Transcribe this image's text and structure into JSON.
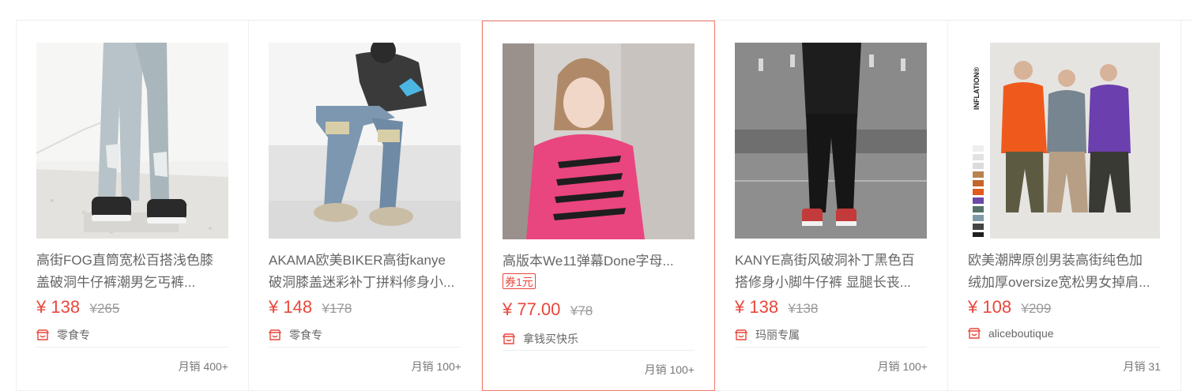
{
  "products": [
    {
      "title_line1": "高街FOG直筒宽松百搭浅色膝",
      "title_line2": "盖破洞牛仔裤潮男乞丐裤...",
      "price": "¥ 138",
      "original_price": "¥265",
      "shop": "零食专",
      "sales": "月销 400+",
      "image_icon": "ripped-jeans-photo"
    },
    {
      "title_line1": "AKAMA欧美BIKER高街kanye",
      "title_line2": "破洞膝盖迷彩补丁拼料修身小...",
      "price": "¥ 148",
      "original_price": "¥178",
      "shop": "零食专",
      "sales": "月销 100+",
      "image_icon": "biker-jeans-photo"
    },
    {
      "title_line1": "高版本We11弹幕Done字母...",
      "coupon": "券1元",
      "price": "¥ 77.00",
      "original_price": "¥78",
      "shop": "拿钱买快乐",
      "sales": "月销 100+",
      "image_icon": "pink-tshirt-photo"
    },
    {
      "title_line1": "KANYE高街风破洞补丁黑色百",
      "title_line2": "搭修身小脚牛仔裤 显腿长丧...",
      "price": "¥ 138",
      "original_price": "¥138",
      "shop": "玛丽专属",
      "sales": "月销 100+",
      "image_icon": "black-jeans-photo"
    },
    {
      "title_line1": "欧美潮牌原创男装高街纯色加",
      "title_line2": "绒加厚oversize宽松男女掉肩...",
      "price": "¥ 108",
      "original_price": "¥209",
      "shop": "aliceboutique",
      "sales": "月销 31",
      "image_icon": "hoodies-photo",
      "brand_text": "INFLATION®"
    }
  ],
  "colors": {
    "price": "#e8473b",
    "active_border": "#f0796b"
  },
  "shop_icon": "store-icon"
}
